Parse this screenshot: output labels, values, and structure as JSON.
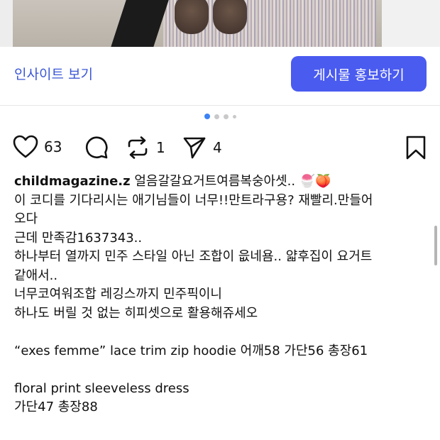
{
  "post": {
    "insight_link": "인사이트 보기",
    "promote_button": "게시물 홍보하기",
    "carousel": {
      "count": 4,
      "active_index": 0
    },
    "actions": {
      "like_count": "63",
      "repost_count": "1",
      "share_count": "4"
    },
    "caption": {
      "username": "childmagazine.z",
      "first_line_text": "얼음갈갈요거트여름복숭아셋..",
      "emoji": "🍧🍑",
      "lines": [
        "이 코디를 기다리시는 애기님들이 너무!!만트라구용? 재빨리.만들어",
        "오다",
        "근데 만족감1637343..",
        "하나부터 열까지 민주 스타일 아닌 조합이 읎네욤.. 얇후집이 요거트",
        "같애서..",
        "너무코여워조합 레깅스까지 민주픽이니",
        "하나도 버릴 것 없는 히피셋으로 활용해쥬세오"
      ],
      "item1": "“exes femme” lace trim zip hoodie 어깨58 가단56 총장61",
      "item2_name": "floral print sleeveless dress",
      "item2_size": "가단47 총장88"
    }
  },
  "colors": {
    "accent": "#4a5bf0",
    "link": "#3b57d6",
    "active_dot": "#3b82f6"
  },
  "icons": [
    "heart-icon",
    "comment-icon",
    "repost-icon",
    "share-icon",
    "bookmark-icon"
  ]
}
